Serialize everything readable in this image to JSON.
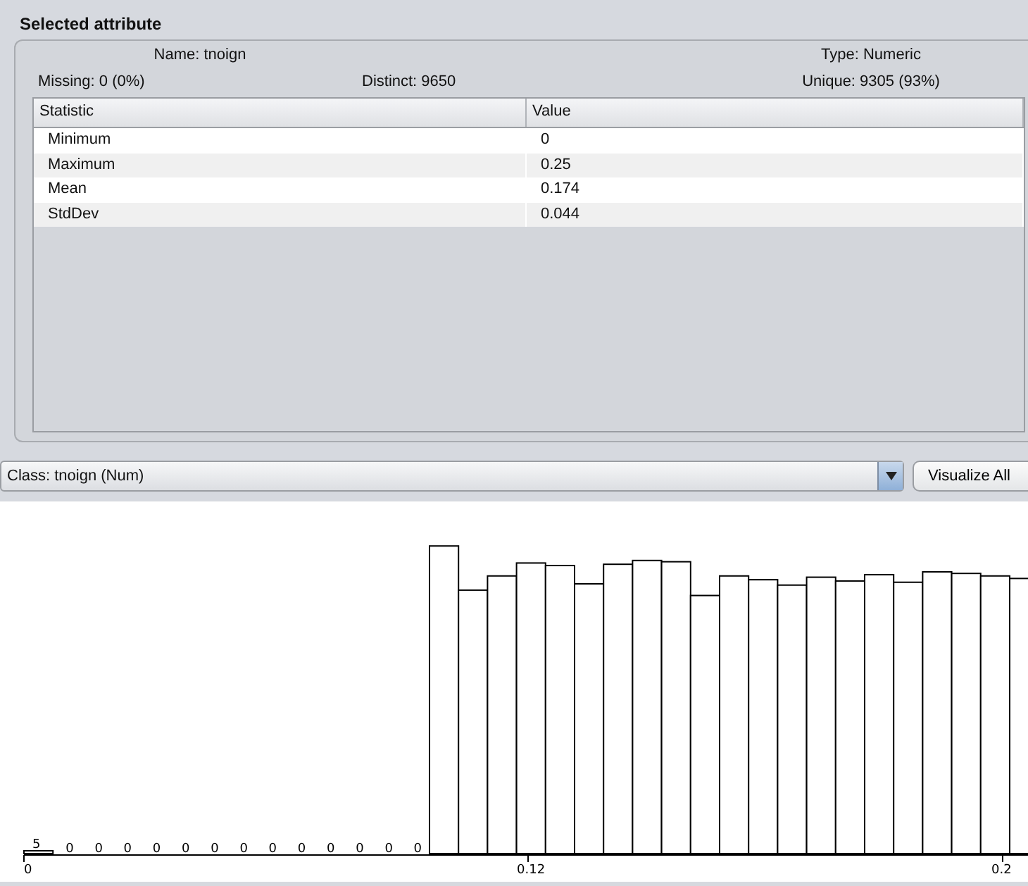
{
  "panel": {
    "title": "Selected attribute"
  },
  "info": {
    "name": "Name: tnoign",
    "type": "Type: Numeric",
    "missing": "Missing: 0 (0%)",
    "distinct": "Distinct: 9650",
    "unique": "Unique: 9305 (93%)"
  },
  "table": {
    "columns": [
      "Statistic",
      "Value"
    ],
    "rows": [
      [
        "Minimum",
        "0"
      ],
      [
        "Maximum",
        "0.25"
      ],
      [
        "Mean",
        "0.174"
      ],
      [
        "StdDev",
        "0.044"
      ]
    ]
  },
  "class_select": {
    "value": "Class: tnoign (Num)"
  },
  "visualize_button": "Visualize All",
  "histogram": {
    "bin_labels": [
      "5",
      "0",
      "0",
      "0",
      "0",
      "0",
      "0",
      "0",
      "0",
      "0",
      "0",
      "0",
      "0",
      "0"
    ],
    "axis_labels": [
      "0",
      "0.12",
      "0.2"
    ]
  }
}
